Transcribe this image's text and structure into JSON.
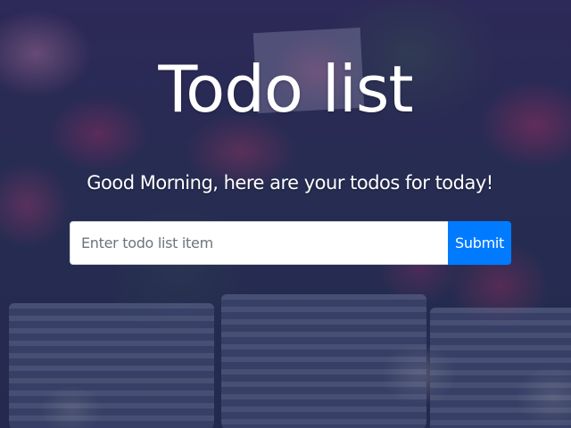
{
  "header": {
    "title": "Todo list",
    "greeting": "Good Morning, here are your todos for today!"
  },
  "todo_form": {
    "input_value": "",
    "input_placeholder": "Enter todo list item",
    "submit_label": "Submit"
  },
  "colors": {
    "submit_button": "#007bff",
    "text": "#ffffff",
    "overlay": "#1c1a46"
  }
}
